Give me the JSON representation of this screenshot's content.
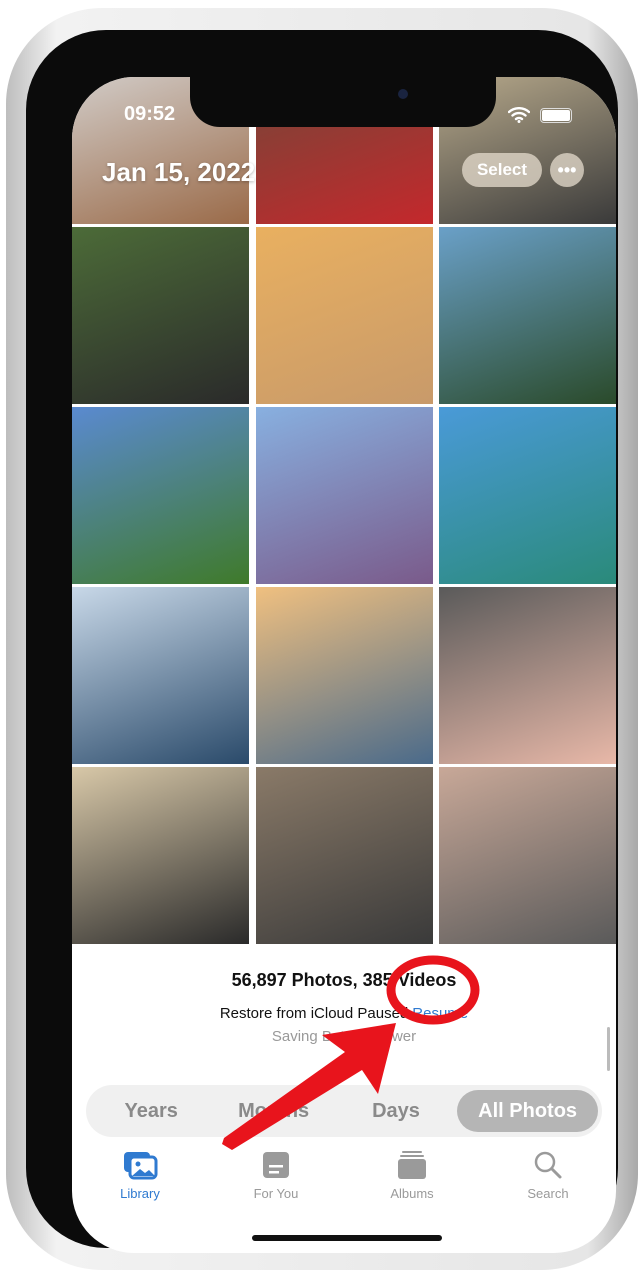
{
  "status_bar": {
    "time": "09:52",
    "icons": [
      "wifi-icon",
      "battery-icon"
    ]
  },
  "header": {
    "date": "Jan 15, 2022",
    "select_label": "Select",
    "more_label": "•••"
  },
  "library": {
    "counts": "56,897 Photos, 385 Videos",
    "restore_status": "Restore from iCloud Paused",
    "resume_label": "Resume",
    "reason": "Saving Battery Power"
  },
  "view_tabs": [
    {
      "label": "Years"
    },
    {
      "label": "Months"
    },
    {
      "label": "Days"
    },
    {
      "label": "All Photos",
      "active": true
    }
  ],
  "tab_bar": [
    {
      "label": "Library",
      "icon": "photo-library-icon",
      "active": true
    },
    {
      "label": "For You",
      "icon": "for-you-icon"
    },
    {
      "label": "Albums",
      "icon": "albums-icon"
    },
    {
      "label": "Search",
      "icon": "search-icon"
    }
  ],
  "colors": {
    "accent": "#2f7ad0",
    "annotation": "#e8141c"
  },
  "photos": [
    [
      "#d9d9d9",
      "#9a6a48"
    ],
    [
      "#6b4a3a",
      "#c4282c"
    ],
    [
      "#c8b896",
      "#3a3a3a"
    ],
    [
      "#4c6b38",
      "#2a2a2a"
    ],
    [
      "#e9b060",
      "#c89a6a"
    ],
    [
      "#6aa0c8",
      "#2a4a2a"
    ],
    [
      "#5a8ad0",
      "#3f7a2a"
    ],
    [
      "#88b0e0",
      "#7a5a8a"
    ],
    [
      "#4a9ad8",
      "#2a8a7a"
    ],
    [
      "#c8d8e8",
      "#2a4a6a"
    ],
    [
      "#f0c080",
      "#4a6a8a"
    ],
    [
      "#5a5a5a",
      "#e8b8a8"
    ],
    [
      "#d8c8a8",
      "#2a2a2a"
    ],
    [
      "#8a7a68",
      "#3a3a3a"
    ],
    [
      "#c8a898",
      "#5a5a5a"
    ]
  ]
}
